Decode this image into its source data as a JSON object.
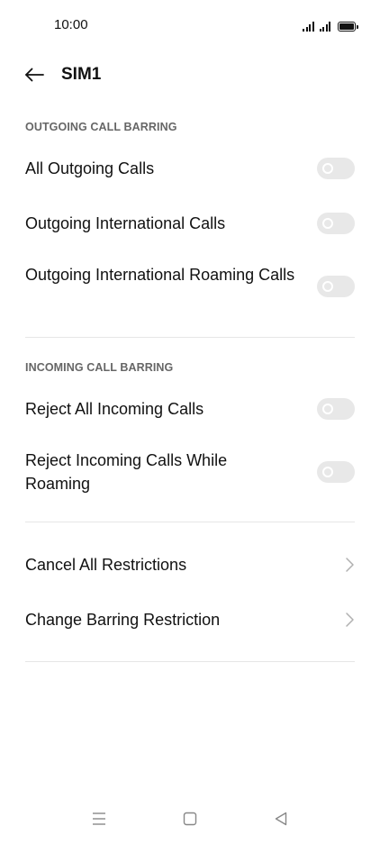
{
  "status_bar": {
    "time": "10:00"
  },
  "header": {
    "title": "SIM1",
    "back_icon": "arrow-left-icon"
  },
  "sections": {
    "outgoing": {
      "header": "OUTGOING CALL BARRING",
      "items": [
        {
          "label": "All Outgoing Calls",
          "enabled": false
        },
        {
          "label": "Outgoing International Calls",
          "enabled": false
        },
        {
          "label": "Outgoing International Roaming Calls",
          "enabled": false
        }
      ]
    },
    "incoming": {
      "header": "INCOMING CALL BARRING",
      "items": [
        {
          "label": "Reject All Incoming Calls",
          "enabled": false
        },
        {
          "label": "Reject Incoming Calls While Roaming",
          "enabled": false
        }
      ]
    },
    "actions": {
      "items": [
        {
          "label": "Cancel All Restrictions",
          "icon": "chevron-right-icon"
        },
        {
          "label": "Change Barring Restriction",
          "icon": "chevron-right-icon"
        }
      ]
    }
  },
  "nav_bar": {
    "icons": [
      "menu-icon",
      "home-icon",
      "back-triangle-icon"
    ]
  },
  "colors": {
    "toggle_off": "#e8e8e8",
    "section_header": "#666666",
    "divider": "#e6e6e6",
    "chevron": "#b0b0b0"
  }
}
